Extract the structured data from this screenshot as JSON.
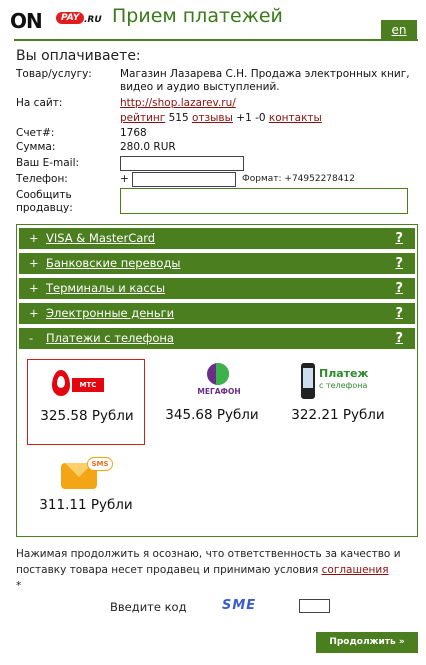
{
  "header": {
    "logo_on": "ON",
    "logo_pay": "PAY",
    "logo_ru": ".RU",
    "title": "Прием платежей",
    "lang_label": "en"
  },
  "order": {
    "heading": "Вы оплачиваете:",
    "product_label": "Товар/услугу:",
    "product_value": "Магазин Лазарева С.Н. Продажа электронных книг, видео и аудио выступлений.",
    "site_label": "На сайт:",
    "site_url": "http://shop.lazarev.ru/",
    "rating_label": "рейтинг",
    "rating_value": "515",
    "reviews_label": "отзывы",
    "votes": "+1 -0",
    "contacts_label": "контакты",
    "invoice_label": "Счет#:",
    "invoice_value": "1768",
    "amount_label": "Сумма:",
    "amount_value": "280.0  RUR",
    "email_label": "Ваш E-mail:",
    "phone_label": "Телефон:",
    "phone_prefix": "+",
    "phone_format": "Формат: +74952278412",
    "message_label": "Сообщить продавцу:"
  },
  "methods": [
    {
      "sign": "+",
      "label": "VISA & MasterCard",
      "help": "?"
    },
    {
      "sign": "+",
      "label": "Банковские переводы",
      "help": "?"
    },
    {
      "sign": "+",
      "label": "Терминалы и кассы",
      "help": "?"
    },
    {
      "sign": "+",
      "label": "Электронные деньги",
      "help": "?"
    },
    {
      "sign": "-",
      "label": "Платежи с телефона",
      "help": "?"
    }
  ],
  "phone_options": [
    {
      "logo_text": "МТС",
      "price": "325.58 Рубли",
      "selected": true
    },
    {
      "logo_text": "МЕГАФОН",
      "price": "345.68 Рубли",
      "selected": false
    },
    {
      "logo_text_1": "Платеж",
      "logo_text_2": "с телефона",
      "price": "322.21 Рубли",
      "selected": false
    },
    {
      "logo_text": "SMS",
      "price": "311.11 Рубли",
      "selected": false
    }
  ],
  "footer": {
    "notice_text": "Нажимая продолжить я осознаю, что ответственность за качество и поставку товара несет продавец и принимаю условия",
    "agreement_link": "соглашения",
    "asterisk": "*",
    "captcha_label": "Введите код",
    "captcha_text": "SME",
    "continue_label": "Продолжить »"
  },
  "colors": {
    "accent": "#4a7e1e",
    "link": "#8a1010",
    "selected_border": "#cc2222"
  }
}
